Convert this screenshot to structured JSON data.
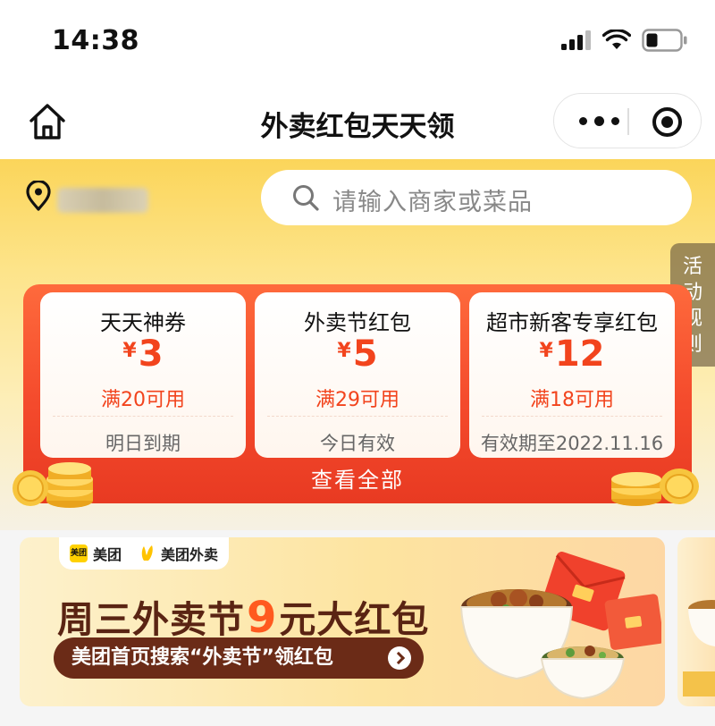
{
  "status_bar": {
    "time": "14:38"
  },
  "nav": {
    "title": "外卖红包天天领"
  },
  "location": {
    "text": ""
  },
  "search": {
    "placeholder": "请输入商家或菜品"
  },
  "rules_tab": {
    "chars": [
      "活",
      "动",
      "规",
      "则"
    ]
  },
  "coupons": [
    {
      "title": "天天神券",
      "currency": "¥",
      "amount": "3",
      "condition": "满20可用",
      "expire": "明日到期"
    },
    {
      "title": "外卖节红包",
      "currency": "¥",
      "amount": "5",
      "condition": "满29可用",
      "expire": "今日有效"
    },
    {
      "title": "超市新客专享红包",
      "currency": "¥",
      "amount": "12",
      "condition": "满18可用",
      "expire": "有效期至2022.11.16"
    }
  ],
  "view_all": {
    "label": "查看全部"
  },
  "banner": {
    "brand1": "美团",
    "brand2": "美团外卖",
    "headline_pre": "周三外卖节",
    "headline_num": "9",
    "headline_post": "元大红包",
    "cta": "美团首页搜索“外卖节”领红包"
  },
  "colors": {
    "accent_red": "#f2441d",
    "hero_yellow": "#fbd55a",
    "banner_brown": "#6b2b17",
    "headline_orange": "#ff5a1f"
  }
}
